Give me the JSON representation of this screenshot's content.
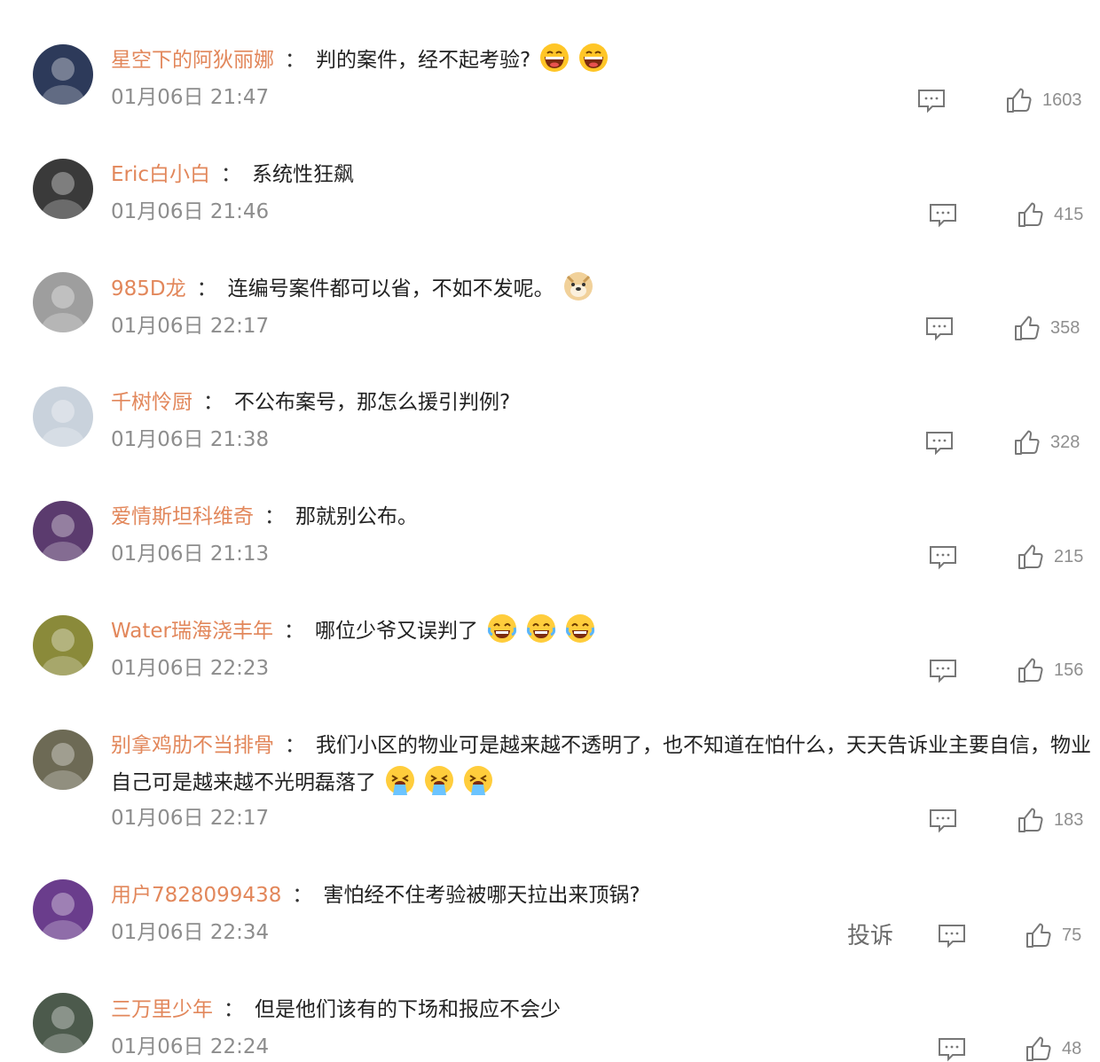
{
  "comments": [
    {
      "user": "星空下的阿狄丽娜",
      "text": "判的案件，经不起考验?",
      "emoji": [
        "grin",
        "grin"
      ],
      "time": "01月06日 21:47",
      "likes": "1603",
      "avatar_color": "#2d3a5a"
    },
    {
      "user": "Eric白小白",
      "text": "系统性狂飙",
      "emoji": [],
      "time": "01月06日 21:46",
      "likes": "415",
      "avatar_color": "#3a3a3a"
    },
    {
      "user": "985D龙",
      "text": "连编号案件都可以省，不如不发呢。",
      "emoji": [
        "doge"
      ],
      "time": "01月06日 22:17",
      "likes": "358",
      "avatar_color": "#9e9e9e"
    },
    {
      "user": "千树怜厨",
      "text": "不公布案号，那怎么援引判例?",
      "emoji": [],
      "time": "01月06日 21:38",
      "likes": "328",
      "avatar_color": "#c9d2dc"
    },
    {
      "user": "爱情斯坦科维奇",
      "text": "那就别公布。",
      "emoji": [],
      "time": "01月06日 21:13",
      "likes": "215",
      "avatar_color": "#5b3b6e"
    },
    {
      "user": "Water瑞海浇丰年",
      "text": "哪位少爷又误判了",
      "emoji": [
        "laugh-cry",
        "laugh-cry",
        "laugh-cry"
      ],
      "time": "01月06日 22:23",
      "likes": "156",
      "avatar_color": "#8a8a3a"
    },
    {
      "user": "别拿鸡肋不当排骨",
      "text": "我们小区的物业可是越来越不透明了，也不知道在怕什么，天天告诉业主要自信，物业自己可是越来越不光明磊落了",
      "emoji": [
        "vomit",
        "vomit",
        "vomit"
      ],
      "time": "01月06日 22:17",
      "likes": "183",
      "avatar_color": "#6d6a55"
    },
    {
      "user": "用户7828099438",
      "text": "害怕经不住考验被哪天拉出来顶锅?",
      "emoji": [],
      "time": "01月06日 22:34",
      "likes": "75",
      "avatar_color": "#6a3d8c",
      "report": "投诉"
    },
    {
      "user": "三万里少年",
      "text": "但是他们该有的下场和报应不会少",
      "emoji": [],
      "time": "01月06日 22:24",
      "likes": "48",
      "avatar_color": "#4c5a4c"
    }
  ],
  "icons": {
    "reply": "comment-bubble-icon",
    "like": "thumbs-up-icon"
  },
  "colors": {
    "username": "#e2875b",
    "time": "#8d8d8d",
    "count": "#8f8f8f"
  }
}
